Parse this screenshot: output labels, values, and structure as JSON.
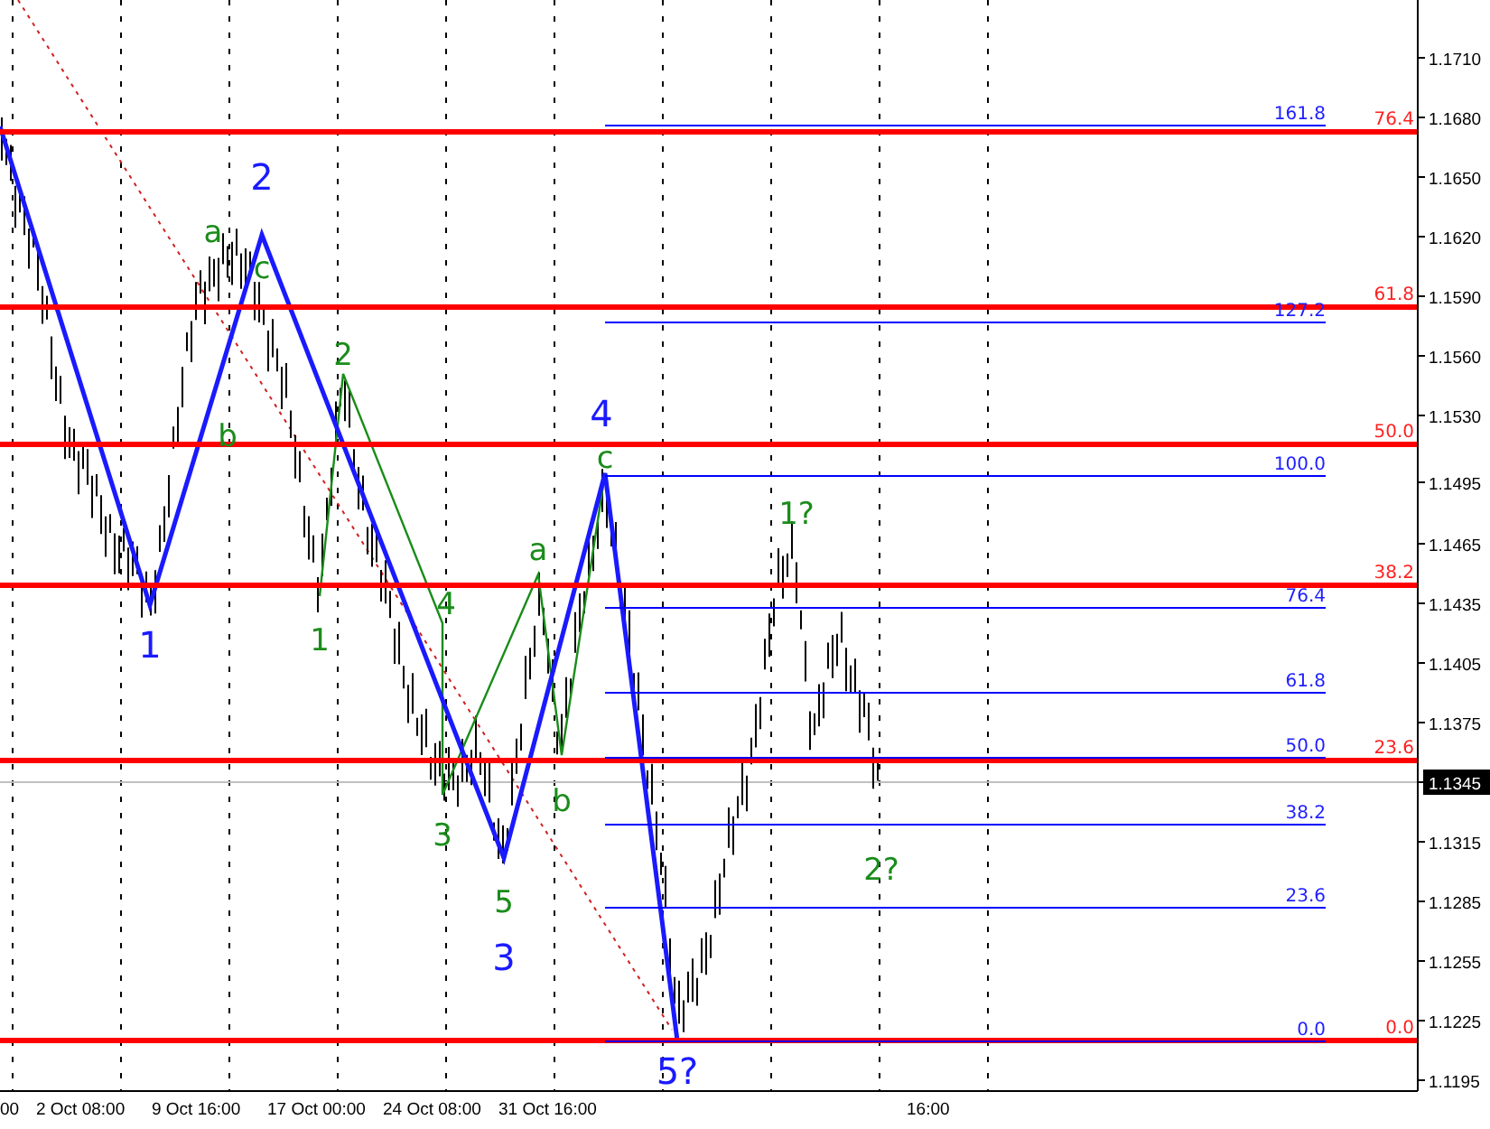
{
  "price_axis": {
    "ticks": [
      {
        "label": "1.1710",
        "current": false
      },
      {
        "label": "1.1680",
        "current": false
      },
      {
        "label": "1.1650",
        "current": false
      },
      {
        "label": "1.1620",
        "current": false
      },
      {
        "label": "1.1590",
        "current": false
      },
      {
        "label": "1.1560",
        "current": false
      },
      {
        "label": "1.1530",
        "current": false
      },
      {
        "label": "1.1495",
        "current": false
      },
      {
        "label": "1.1465",
        "current": false
      },
      {
        "label": "1.1435",
        "current": false
      },
      {
        "label": "1.1405",
        "current": false
      },
      {
        "label": "1.1375",
        "current": false
      },
      {
        "label": "1.1345",
        "current": true
      },
      {
        "label": "1.1315",
        "current": false
      },
      {
        "label": "1.1285",
        "current": false
      },
      {
        "label": "1.1255",
        "current": false
      },
      {
        "label": "1.1225",
        "current": false
      },
      {
        "label": "1.1195",
        "current": false
      }
    ]
  },
  "time_axis": {
    "labels": [
      "00",
      "2 Oct 08:00",
      "9 Oct 16:00",
      "17 Oct 00:00",
      "24 Oct 08:00",
      "31 Oct 16:00",
      "16:00"
    ]
  },
  "retracement_levels": [
    {
      "label": "76.4"
    },
    {
      "label": "61.8"
    },
    {
      "label": "50.0"
    },
    {
      "label": "38.2"
    },
    {
      "label": "23.6"
    },
    {
      "label": "0.0"
    }
  ],
  "extension_levels": [
    {
      "label": "161.8"
    },
    {
      "label": "127.2"
    },
    {
      "label": "100.0"
    },
    {
      "label": "76.4"
    },
    {
      "label": "61.8"
    },
    {
      "label": "50.0"
    },
    {
      "label": "38.2"
    },
    {
      "label": "23.6"
    },
    {
      "label": "0.0"
    }
  ],
  "wave_labels": [
    {
      "text": "2",
      "kind": "major",
      "color": "#1a1aff"
    },
    {
      "text": "a",
      "kind": "minor",
      "color": "#1a8c1a"
    },
    {
      "text": "c",
      "kind": "minor",
      "color": "#1a8c1a"
    },
    {
      "text": "b",
      "kind": "minor",
      "color": "#1a8c1a"
    },
    {
      "text": "1",
      "kind": "major",
      "color": "#1a1aff"
    },
    {
      "text": "1",
      "kind": "minor",
      "color": "#1a8c1a"
    },
    {
      "text": "2",
      "kind": "minor",
      "color": "#1a8c1a"
    },
    {
      "text": "4",
      "kind": "minor",
      "color": "#1a8c1a"
    },
    {
      "text": "3",
      "kind": "minor",
      "color": "#1a8c1a"
    },
    {
      "text": "5",
      "kind": "minor",
      "color": "#1a8c1a"
    },
    {
      "text": "3",
      "kind": "major",
      "color": "#1a1aff"
    },
    {
      "text": "a",
      "kind": "minor",
      "color": "#1a8c1a"
    },
    {
      "text": "b",
      "kind": "minor",
      "color": "#1a8c1a"
    },
    {
      "text": "4",
      "kind": "major",
      "color": "#1a1aff"
    },
    {
      "text": "c",
      "kind": "minor",
      "color": "#1a8c1a"
    },
    {
      "text": "1?",
      "kind": "minor",
      "color": "#1a8c1a"
    },
    {
      "text": "2?",
      "kind": "minor",
      "color": "#1a8c1a"
    },
    {
      "text": "5?",
      "kind": "major",
      "color": "#1a1aff"
    }
  ]
}
